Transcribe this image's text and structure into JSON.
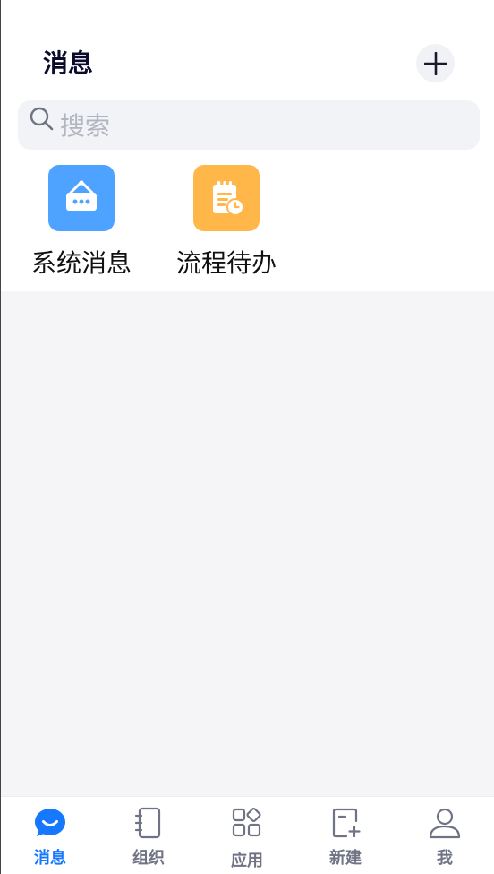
{
  "header": {
    "title": "消息"
  },
  "search": {
    "placeholder": "搜索"
  },
  "quick_entries": [
    {
      "label": "系统消息",
      "icon": "announcement-board-icon",
      "color": "#4da3ff"
    },
    {
      "label": "流程待办",
      "icon": "clipboard-clock-icon",
      "color": "#ffb74a"
    }
  ],
  "tabbar": {
    "accent_color": "#1677ff",
    "items": [
      {
        "label": "消息",
        "icon": "chat-bubble-icon",
        "active": true
      },
      {
        "label": "组织",
        "icon": "contacts-book-icon",
        "active": false
      },
      {
        "label": "应用",
        "icon": "apps-grid-icon",
        "active": false
      },
      {
        "label": "新建",
        "icon": "new-item-icon",
        "active": false
      },
      {
        "label": "我",
        "icon": "user-icon",
        "active": false
      }
    ]
  }
}
